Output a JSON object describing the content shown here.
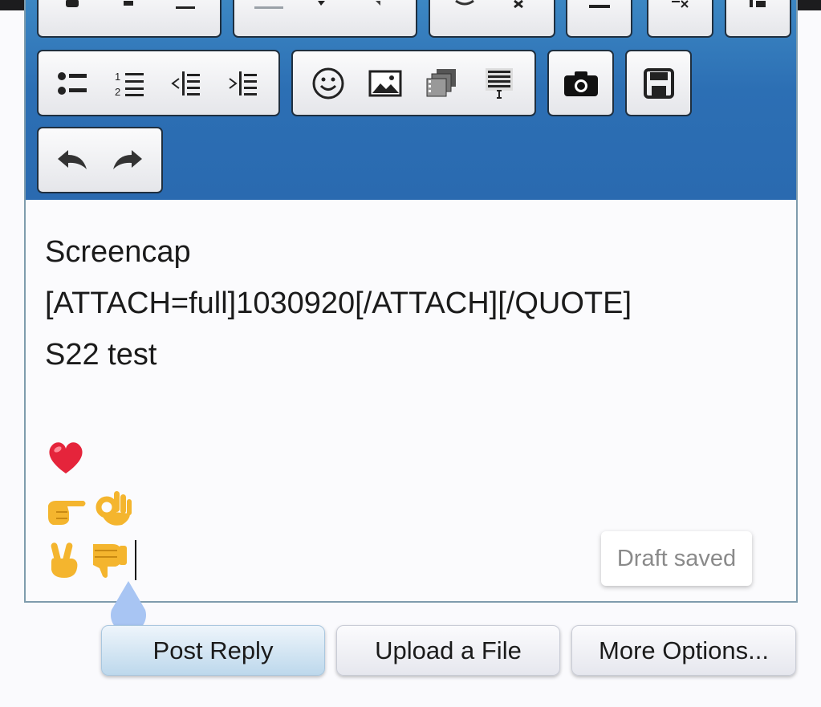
{
  "editor": {
    "lines": [
      "Screencap",
      "[ATTACH=full]1030920[/ATTACH][/QUOTE]",
      "S22 test"
    ],
    "emoji_rows": [
      [
        "❤️"
      ],
      [
        "👉",
        "👌"
      ],
      [
        "✌️",
        "👎"
      ]
    ]
  },
  "toolbar": {
    "row1": [
      "bold-icon",
      "italic-icon",
      "underline-icon",
      "text-color-icon",
      "font-size-icon",
      "font-family-icon",
      "link-icon",
      "unlink-icon",
      "horizontal-rule-icon",
      "remove-format-icon",
      "toggle-bbcode-icon"
    ],
    "row2": [
      "bullet-list-icon",
      "numbered-list-icon",
      "outdent-icon",
      "indent-icon",
      "smilies-icon",
      "image-icon",
      "media-icon",
      "insert-quote-icon",
      "camera-icon",
      "save-draft-icon"
    ],
    "row3": [
      "undo-icon",
      "redo-icon"
    ]
  },
  "status": {
    "draft_label": "Draft saved"
  },
  "actions": {
    "post_reply": "Post Reply",
    "upload_file": "Upload a File",
    "more_options": "More Options..."
  },
  "colors": {
    "toolbar_top": "#3c87c3",
    "toolbar_bottom": "#2a6ab0",
    "post_button": "#bdd8ec",
    "caret_handle": "#a8c5f3"
  }
}
